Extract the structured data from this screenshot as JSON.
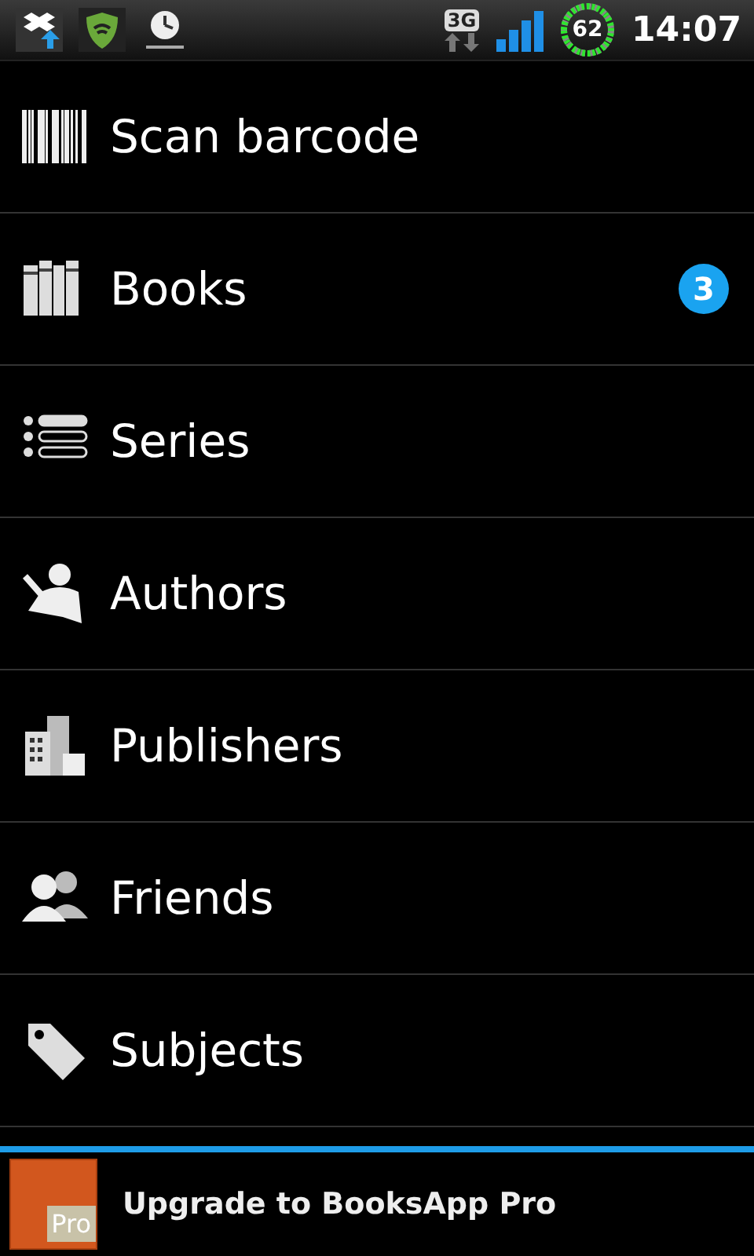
{
  "status_bar": {
    "network": "3G",
    "battery": "62",
    "time": "14:07"
  },
  "menu": [
    {
      "kind": "barcode",
      "label": "Scan barcode"
    },
    {
      "kind": "books",
      "label": "Books",
      "badge": "3"
    },
    {
      "kind": "series",
      "label": "Series"
    },
    {
      "kind": "authors",
      "label": "Authors"
    },
    {
      "kind": "publishers",
      "label": "Publishers"
    },
    {
      "kind": "friends",
      "label": "Friends"
    },
    {
      "kind": "subjects",
      "label": "Subjects"
    }
  ],
  "ad": {
    "text": "Upgrade to BooksApp Pro",
    "icon_text": "Pro"
  }
}
